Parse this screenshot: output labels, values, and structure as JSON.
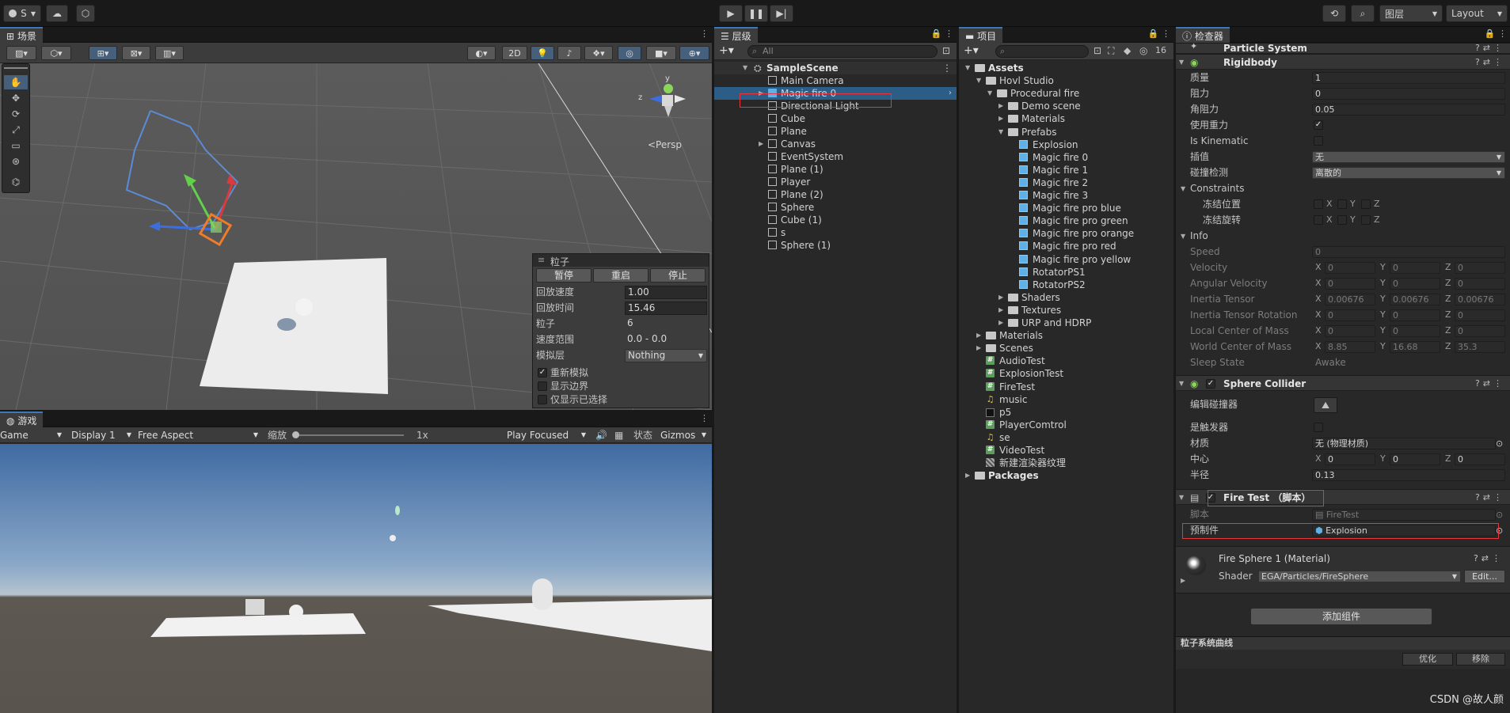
{
  "topbar": {
    "account_label": "S",
    "layers_label": "图层",
    "layout_label": "Layout"
  },
  "scene": {
    "tab_label": "场景",
    "btn_2d": "2D",
    "persp_label": "<Persp",
    "gizmo_y": "y",
    "gizmo_z": "z",
    "particle_overlay": {
      "title": "粒子",
      "buttons": [
        "暂停",
        "重启",
        "停止"
      ],
      "rows": [
        {
          "label": "回放速度",
          "value": "1.00"
        },
        {
          "label": "回放时间",
          "value": "15.46"
        },
        {
          "label": "粒子",
          "value": "6"
        },
        {
          "label": "速度范围",
          "value": "0.0 - 0.0"
        },
        {
          "label": "模拟层",
          "value": "Nothing"
        }
      ],
      "checks": [
        {
          "label": "重新模拟",
          "checked": true
        },
        {
          "label": "显示边界",
          "checked": false
        },
        {
          "label": "仅显示已选择",
          "checked": false
        }
      ]
    }
  },
  "game": {
    "tab_label": "游戏",
    "mode": "Game",
    "display": "Display 1",
    "aspect": "Free Aspect",
    "scale_label": "缩放",
    "scale_value": "1x",
    "play_focused": "Play Focused",
    "stats": "状态",
    "gizmos": "Gizmos"
  },
  "hierarchy": {
    "tab_label": "层级",
    "search_placeholder": "All",
    "scene_name": "SampleScene",
    "items": [
      {
        "label": "Main Camera",
        "arrow": false
      },
      {
        "label": "Magic fire 0",
        "arrow": true,
        "selected": true
      },
      {
        "label": "Directional Light",
        "arrow": false
      },
      {
        "label": "Cube",
        "arrow": false
      },
      {
        "label": "Plane",
        "arrow": false
      },
      {
        "label": "Canvas",
        "arrow": true
      },
      {
        "label": "EventSystem",
        "arrow": false
      },
      {
        "label": "Plane (1)",
        "arrow": false
      },
      {
        "label": "Player",
        "arrow": false
      },
      {
        "label": "Plane (2)",
        "arrow": false
      },
      {
        "label": "Sphere",
        "arrow": false
      },
      {
        "label": "Cube (1)",
        "arrow": false
      },
      {
        "label": "s",
        "arrow": false
      },
      {
        "label": "Sphere (1)",
        "arrow": false
      }
    ]
  },
  "project": {
    "tab_label": "项目",
    "hidden_count": "16",
    "tree": [
      {
        "label": "Assets",
        "depth": 0,
        "type": "folder",
        "arrow": "down",
        "bold": true
      },
      {
        "label": "Hovl Studio",
        "depth": 1,
        "type": "folder",
        "arrow": "down"
      },
      {
        "label": "Procedural fire",
        "depth": 2,
        "type": "folder",
        "arrow": "down"
      },
      {
        "label": "Demo scene",
        "depth": 3,
        "type": "folder",
        "arrow": "right"
      },
      {
        "label": "Materials",
        "depth": 3,
        "type": "folder",
        "arrow": "right"
      },
      {
        "label": "Prefabs",
        "depth": 3,
        "type": "folder",
        "arrow": "down"
      },
      {
        "label": "Explosion",
        "depth": 4,
        "type": "prefab"
      },
      {
        "label": "Magic fire 0",
        "depth": 4,
        "type": "prefab"
      },
      {
        "label": "Magic fire 1",
        "depth": 4,
        "type": "prefab"
      },
      {
        "label": "Magic fire 2",
        "depth": 4,
        "type": "prefab"
      },
      {
        "label": "Magic fire 3",
        "depth": 4,
        "type": "prefab"
      },
      {
        "label": "Magic fire pro blue",
        "depth": 4,
        "type": "prefab"
      },
      {
        "label": "Magic fire pro green",
        "depth": 4,
        "type": "prefab"
      },
      {
        "label": "Magic fire pro orange",
        "depth": 4,
        "type": "prefab"
      },
      {
        "label": "Magic fire pro red",
        "depth": 4,
        "type": "prefab"
      },
      {
        "label": "Magic fire pro yellow",
        "depth": 4,
        "type": "prefab"
      },
      {
        "label": "RotatorPS1",
        "depth": 4,
        "type": "prefab"
      },
      {
        "label": "RotatorPS2",
        "depth": 4,
        "type": "prefab"
      },
      {
        "label": "Shaders",
        "depth": 3,
        "type": "folder",
        "arrow": "right"
      },
      {
        "label": "Textures",
        "depth": 3,
        "type": "folder",
        "arrow": "right"
      },
      {
        "label": "URP and HDRP",
        "depth": 3,
        "type": "folder",
        "arrow": "right"
      },
      {
        "label": "Materials",
        "depth": 1,
        "type": "folder",
        "arrow": "right"
      },
      {
        "label": "Scenes",
        "depth": 1,
        "type": "folder",
        "arrow": "right"
      },
      {
        "label": "AudioTest",
        "depth": 1,
        "type": "script"
      },
      {
        "label": "ExplosionTest",
        "depth": 1,
        "type": "script"
      },
      {
        "label": "FireTest",
        "depth": 1,
        "type": "script"
      },
      {
        "label": "music",
        "depth": 1,
        "type": "audio"
      },
      {
        "label": "p5",
        "depth": 1,
        "type": "image"
      },
      {
        "label": "PlayerComtrol",
        "depth": 1,
        "type": "script"
      },
      {
        "label": "se",
        "depth": 1,
        "type": "audio"
      },
      {
        "label": "VideoTest",
        "depth": 1,
        "type": "script"
      },
      {
        "label": "新建渲染器纹理",
        "depth": 1,
        "type": "texture"
      },
      {
        "label": "Packages",
        "depth": 0,
        "type": "folder",
        "arrow": "right",
        "bold": true
      }
    ]
  },
  "inspector": {
    "tab_label": "检查器",
    "particle_system": "Particle System",
    "rigidbody": {
      "title": "Rigidbody",
      "mass_label": "质量",
      "mass": "1",
      "drag_label": "阻力",
      "drag": "0",
      "angular_drag_label": "角阻力",
      "angular_drag": "0.05",
      "use_gravity_label": "使用重力",
      "is_kinematic_label": "Is Kinematic",
      "interpolate_label": "插值",
      "interpolate": "无",
      "collision_label": "碰撞检测",
      "collision": "离散的",
      "constraints_label": "Constraints",
      "freeze_pos_label": "冻结位置",
      "freeze_rot_label": "冻结旋转",
      "info_label": "Info",
      "speed_label": "Speed",
      "speed": "0",
      "velocity_label": "Velocity",
      "velocity": [
        "0",
        "0",
        "0"
      ],
      "ang_vel_label": "Angular Velocity",
      "ang_vel": [
        "0",
        "0",
        "0"
      ],
      "inertia_label": "Inertia Tensor",
      "inertia": [
        "0.00676",
        "0.00676",
        "0.00676"
      ],
      "inertia_rot_label": "Inertia Tensor Rotation",
      "inertia_rot": [
        "0",
        "0",
        "0"
      ],
      "local_com_label": "Local Center of Mass",
      "local_com": [
        "0",
        "0",
        "0"
      ],
      "world_com_label": "World Center of Mass",
      "world_com": [
        "8.85",
        "16.68",
        "35.3"
      ],
      "sleep_label": "Sleep State",
      "sleep": "Awake"
    },
    "sphere_collider": {
      "title": "Sphere Collider",
      "edit_label": "编辑碰撞器",
      "trigger_label": "是触发器",
      "material_label": "材质",
      "material": "无 (物理材质)",
      "center_label": "中心",
      "center": [
        "0",
        "0",
        "0"
      ],
      "radius_label": "半径",
      "radius": "0.13"
    },
    "fire_test": {
      "title": "Fire Test （脚本）",
      "script_label": "脚本",
      "script": "FireTest",
      "prefab_label": "预制件",
      "prefab": "Explosion"
    },
    "material": {
      "title": "Fire Sphere 1 (Material)",
      "shader_label": "Shader",
      "shader": "EGA/Particles/FireSphere",
      "edit": "Edit..."
    },
    "add_component": "添加组件",
    "curves_title": "粒子系统曲线",
    "optimize": "优化",
    "remove": "移除"
  },
  "watermark": "CSDN @故人颜",
  "axis_labels": {
    "x": "X",
    "y": "Y",
    "z": "Z"
  }
}
